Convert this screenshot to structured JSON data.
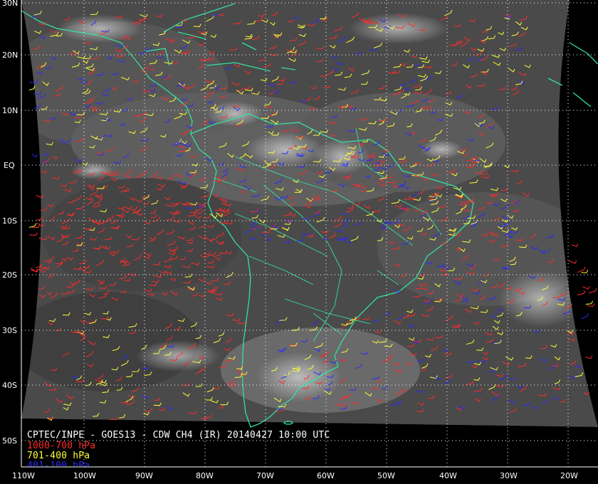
{
  "title": "CPTEC/INPE - GOES13 - CDW CH4 (IR) 20140427 10:00 UTC",
  "legend": [
    {
      "label": "1000-700 hPa",
      "color": "#ff2a2a"
    },
    {
      "label": "701-400 hPa",
      "color": "#ffff3a"
    },
    {
      "label": "401-100 hPa",
      "color": "#2a2aff"
    }
  ],
  "lat_labels": [
    "30N",
    "20N",
    "10N",
    "EQ",
    "10S",
    "20S",
    "30S",
    "40S",
    "50S"
  ],
  "lon_labels": [
    "110W",
    "100W",
    "90W",
    "80W",
    "70W",
    "60W",
    "50W",
    "40W",
    "30W",
    "20W"
  ],
  "colors": {
    "coastline": "#33e0a0",
    "grid": "#ffffff",
    "background": "#000000"
  }
}
